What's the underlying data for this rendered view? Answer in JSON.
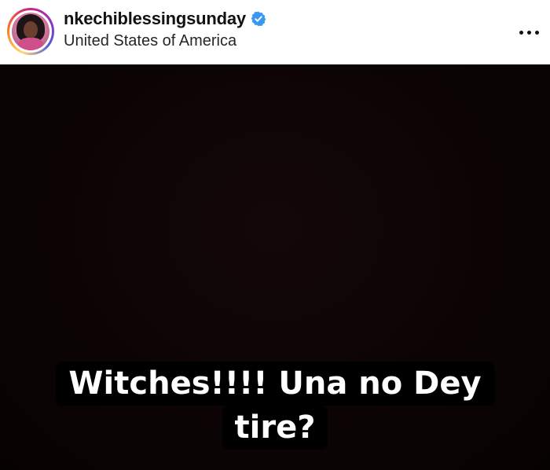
{
  "post": {
    "username": "nkechiblessingsunday",
    "verified": true,
    "location": "United States of America",
    "more_icon": "more-horizontal-icon",
    "media": {
      "caption_lines": [
        "Witches!!!! Una no Dey",
        "tire?"
      ],
      "background_color": "#0c0404",
      "caption_bg_color": "#000000",
      "caption_text_color": "#ffffff"
    },
    "colors": {
      "verified_badge": "#3897f0",
      "text_primary": "#121212"
    }
  }
}
